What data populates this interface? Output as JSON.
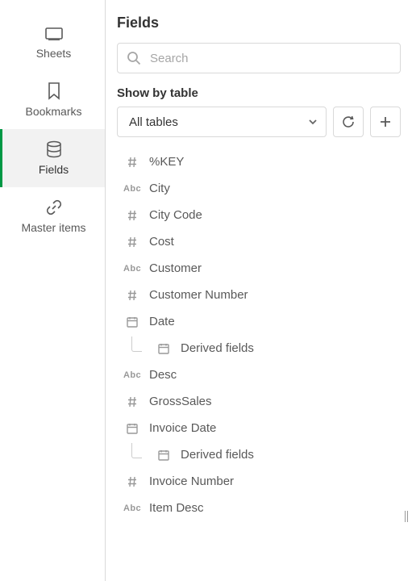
{
  "sidebar": {
    "items": [
      {
        "label": "Sheets"
      },
      {
        "label": "Bookmarks"
      },
      {
        "label": "Fields"
      },
      {
        "label": "Master items"
      }
    ]
  },
  "panel": {
    "title": "Fields",
    "search_placeholder": "Search",
    "show_by_label": "Show by table",
    "table_selector_value": "All tables"
  },
  "fields": [
    {
      "type": "hash",
      "name": "%KEY"
    },
    {
      "type": "abc",
      "name": "City"
    },
    {
      "type": "hash",
      "name": "City Code"
    },
    {
      "type": "hash",
      "name": "Cost"
    },
    {
      "type": "abc",
      "name": "Customer"
    },
    {
      "type": "hash",
      "name": "Customer Number"
    },
    {
      "type": "date",
      "name": "Date"
    },
    {
      "type": "date",
      "name": "Derived fields",
      "indent": true
    },
    {
      "type": "abc",
      "name": "Desc"
    },
    {
      "type": "hash",
      "name": "GrossSales"
    },
    {
      "type": "date",
      "name": "Invoice Date"
    },
    {
      "type": "date",
      "name": "Derived fields",
      "indent": true
    },
    {
      "type": "hash",
      "name": "Invoice Number"
    },
    {
      "type": "abc",
      "name": "Item Desc"
    }
  ]
}
